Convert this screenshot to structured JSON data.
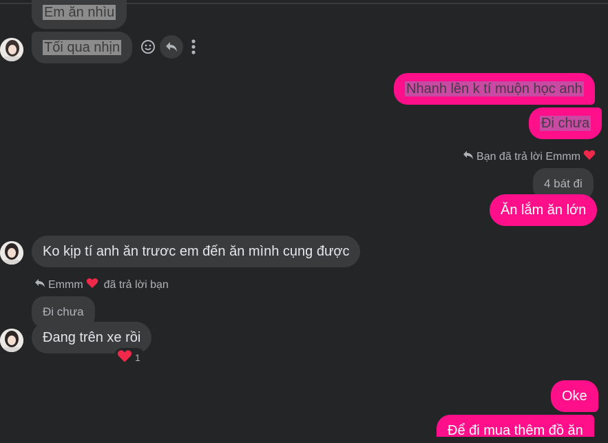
{
  "messages": {
    "m1": "Em ăn nhìu",
    "m2": "Tối qua nhịn",
    "m3": "Nhanh lên k tí muộn học anh",
    "m4": "Đi chưa",
    "reply1": {
      "context": "Bạn đã trả lời Emmm",
      "quoted": "4 bát đi",
      "text": "Ăn lắm ăn lớn"
    },
    "m5": "Ko kịp tí anh ăn trươc em đến ăn mình cụng được",
    "reply2": {
      "context_name": "Emmm",
      "context_rest": "đã trả lời bạn",
      "quoted": "Đi chưa",
      "text": "Đang trên xe rồi",
      "reaction_count": "1"
    },
    "m6": "Oke",
    "m7": "Để đi mua thêm đồ ăn"
  },
  "colors": {
    "background": "#242526",
    "incoming_bubble": "#3a3b3c",
    "outgoing_bubble": "#ff0f8a",
    "heart": "#f02849"
  },
  "icons": [
    "smiley-icon",
    "reply-icon",
    "more-vertical-icon",
    "heart-icon",
    "reply-arrow-icon"
  ]
}
